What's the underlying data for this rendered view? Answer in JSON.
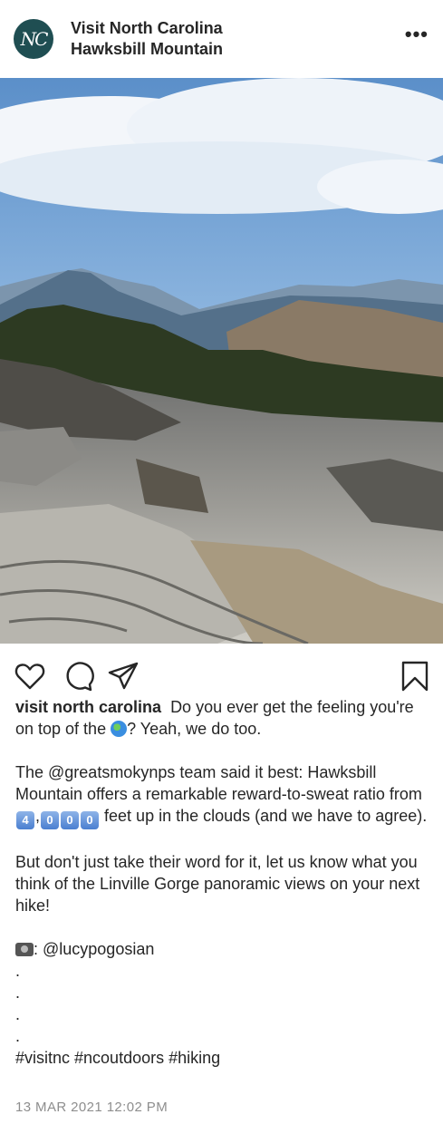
{
  "post": {
    "account_name": "Visit North Carolina",
    "location": "Hawksbill Mountain",
    "avatar_initials": "NC",
    "more_label": "•••"
  },
  "caption": {
    "username": "visit north carolina",
    "line1_a": "Do you ever get the feeling you're on top of the",
    "line1_b": "? Yeah, we do too.",
    "p2_a": "The @greatsmokynps team said it best: Hawksbill Mountain offers a remarkable reward-to-sweat ratio from",
    "digits": [
      "4",
      "0",
      "0",
      "0"
    ],
    "p2_b": "feet up in the clouds (and we have to agree).",
    "p3": "But don't just take their word for it, let us know what you think of the Linville Gorge panoramic views on your next hike!",
    "credit": ": @lucypogosian",
    "dots": [
      ".",
      ".",
      ".",
      "."
    ],
    "hashtags": "#visitnc #ncoutdoors #hiking"
  },
  "timestamp": "13 MAR 2021 12:02 PM",
  "colors": {
    "avatar_bg": "#1f4e52",
    "text": "#262626",
    "muted": "#8e8e8e"
  }
}
